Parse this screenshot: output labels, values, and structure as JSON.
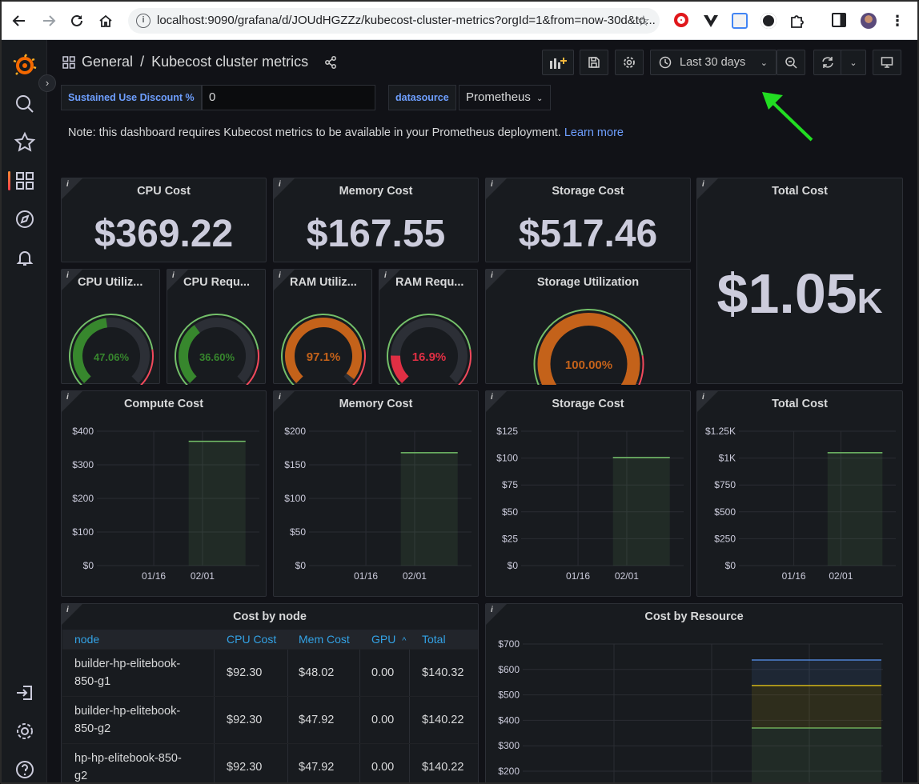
{
  "browser": {
    "url": "localhost:9090/grafana/d/JOUdHGZZz/kubecost-cluster-metrics?orgId=1&from=now-30d&to..."
  },
  "header": {
    "breadcrumb_folder": "General",
    "separator": "/",
    "dashboard_title": "Kubecost cluster metrics",
    "time_range": "Last 30 days"
  },
  "variables": {
    "discount_label": "Sustained Use Discount %",
    "discount_value": "0",
    "datasource_label": "datasource",
    "datasource_value": "Prometheus"
  },
  "note": {
    "text": "Note: this dashboard requires Kubecost metrics to be available in your Prometheus deployment.",
    "link": "Learn more"
  },
  "stats": {
    "cpu": {
      "title": "CPU Cost",
      "value": "$369.22"
    },
    "memory": {
      "title": "Memory Cost",
      "value": "$167.55"
    },
    "storage": {
      "title": "Storage Cost",
      "value": "$517.46"
    },
    "total": {
      "title": "Total Cost",
      "value": "$1.05",
      "unit": "K"
    }
  },
  "gauges": [
    {
      "title": "CPU Utiliz...",
      "label": "47.06%",
      "value": 47.06,
      "color": "#37872d"
    },
    {
      "title": "CPU Requ...",
      "label": "36.60%",
      "value": 36.6,
      "color": "#37872d"
    },
    {
      "title": "RAM Utiliz...",
      "label": "97.1%",
      "value": 97.1,
      "color": "#c4621a"
    },
    {
      "title": "RAM Requ...",
      "label": "16.9%",
      "value": 16.9,
      "color": "#e02f44"
    },
    {
      "title": "Storage Utilization",
      "label": "100.00%",
      "value": 100,
      "color": "#c4621a"
    }
  ],
  "chart_data": [
    {
      "type": "bar",
      "title": "Compute Cost",
      "x": [
        "01/16",
        "02/01"
      ],
      "yticks": [
        "$0",
        "$100",
        "$200",
        "$300",
        "$400"
      ],
      "ylim": [
        0,
        400
      ],
      "values": [
        370
      ],
      "ylabel": "",
      "xlabel": ""
    },
    {
      "type": "bar",
      "title": "Memory Cost",
      "x": [
        "01/16",
        "02/01"
      ],
      "yticks": [
        "$0",
        "$50",
        "$100",
        "$150",
        "$200"
      ],
      "ylim": [
        0,
        200
      ],
      "values": [
        168
      ],
      "ylabel": "",
      "xlabel": ""
    },
    {
      "type": "bar",
      "title": "Storage Cost",
      "x": [
        "01/16",
        "02/01"
      ],
      "yticks": [
        "$0",
        "$25",
        "$50",
        "$75",
        "$100",
        "$125"
      ],
      "ylim": [
        0,
        125
      ],
      "values": [
        100.5
      ],
      "ylabel": "",
      "xlabel": ""
    },
    {
      "type": "bar",
      "title": "Total Cost",
      "x": [
        "01/16",
        "02/01"
      ],
      "yticks": [
        "$0",
        "$250",
        "$500",
        "$750",
        "$1K",
        "$1.25K"
      ],
      "ylim": [
        0,
        1250
      ],
      "values": [
        1050
      ],
      "ylabel": "",
      "xlabel": ""
    },
    {
      "type": "area",
      "title": "Cost by Resource",
      "yticks": [
        "$200",
        "$300",
        "$400",
        "$500",
        "$600",
        "$700"
      ],
      "ylim": [
        200,
        700
      ],
      "series": [
        {
          "values": [
            370
          ]
        },
        {
          "values": [
            537
          ]
        },
        {
          "values": [
            637
          ]
        }
      ],
      "ylabel": "",
      "xlabel": ""
    }
  ],
  "table": {
    "title": "Cost by node",
    "columns": [
      "node",
      "CPU Cost",
      "Mem Cost",
      "GPU",
      "Total"
    ],
    "sort_indicator": "^",
    "rows": [
      {
        "node1": "builder-hp-elitebook-",
        "node2": "850-g1",
        "cpu": "$92.30",
        "mem": "$48.02",
        "gpu": "0.00",
        "total": "$140.32"
      },
      {
        "node1": "builder-hp-elitebook-",
        "node2": "850-g2",
        "cpu": "$92.30",
        "mem": "$47.92",
        "gpu": "0.00",
        "total": "$140.22"
      },
      {
        "node1": "hp-hp-elitebook-850-",
        "node2": "g2",
        "cpu": "$92.30",
        "mem": "$47.92",
        "gpu": "0.00",
        "total": "$140.22"
      }
    ]
  },
  "colors": {
    "accent": "#6e9fff",
    "green": "#73bf69",
    "orange": "#c4621a",
    "red": "#e02f44",
    "annotation_arrow": "#22dd22"
  }
}
